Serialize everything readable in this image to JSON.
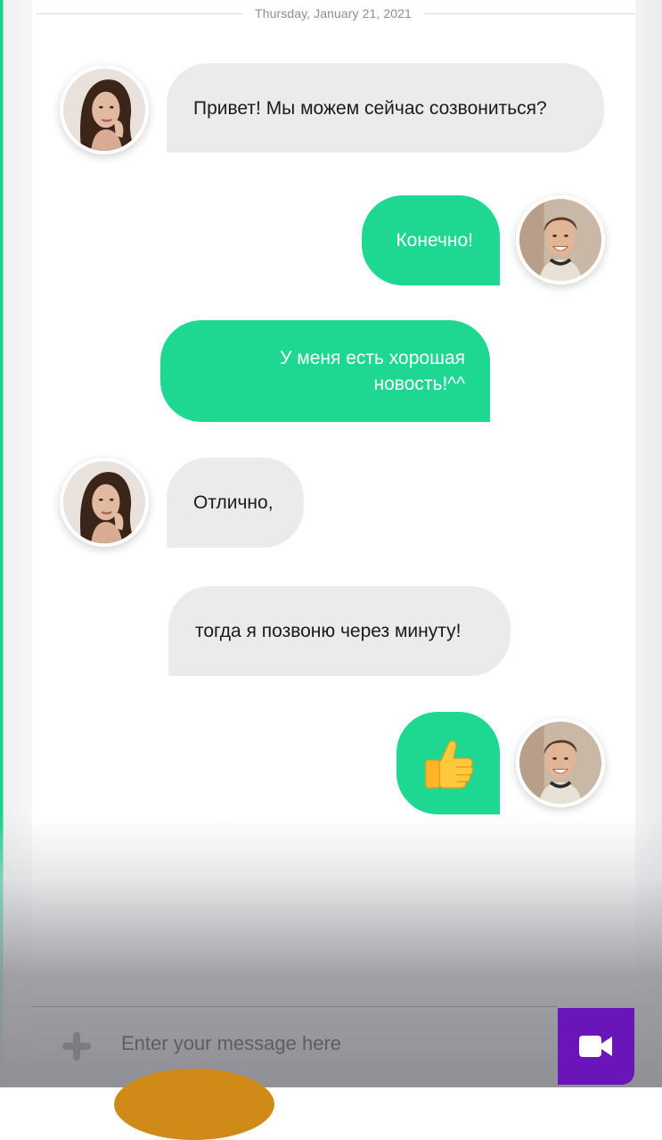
{
  "date_separator": "Thursday,  January 21, 2021",
  "messages": [
    {
      "from": "her",
      "text": "Привет! Мы можем сейчас созвониться?"
    },
    {
      "from": "me",
      "text": "Конечно!"
    },
    {
      "from": "me",
      "text": "У меня есть хорошая новость!^^"
    },
    {
      "from": "her",
      "text": "Отлично,"
    },
    {
      "from": "her",
      "text": "тогда я позвоню через минуту!"
    },
    {
      "from": "me",
      "icon": "thumbs-up-icon"
    }
  ],
  "composer": {
    "placeholder": "Enter your message here",
    "add_icon": "plus-icon",
    "video_icon": "video-camera-icon"
  },
  "colors": {
    "incoming_bubble": "#ebebeb",
    "outgoing_bubble": "#1ed892",
    "video_button": "#6a15b9"
  }
}
